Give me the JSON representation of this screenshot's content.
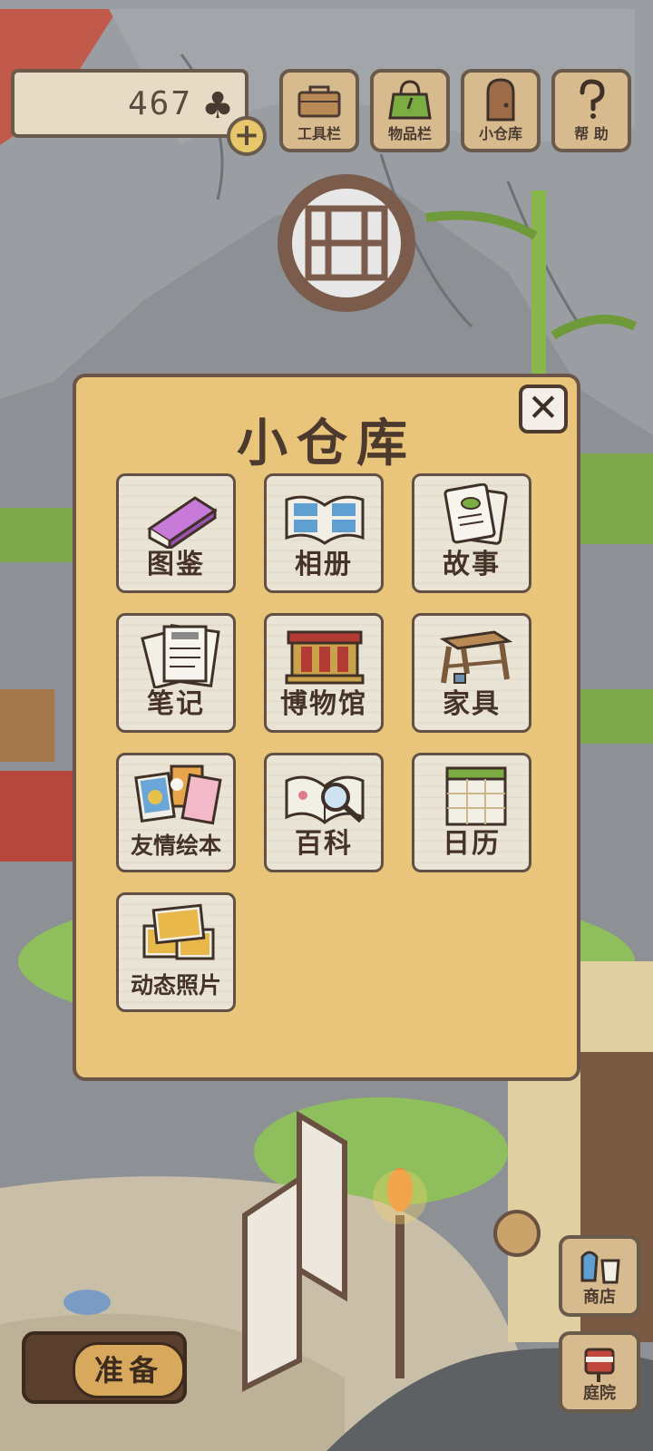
{
  "hud": {
    "clover_count": "467",
    "clover_icon": "clover-icon",
    "add_icon": "plus-icon"
  },
  "toolbar": [
    {
      "label": "工具栏",
      "icon": "toolbox-icon"
    },
    {
      "label": "物品栏",
      "icon": "bag-icon"
    },
    {
      "label": "小仓库",
      "icon": "door-icon"
    },
    {
      "label": "帮 助",
      "icon": "question-icon"
    }
  ],
  "storage_panel": {
    "title": "小仓库",
    "close_icon": "close-icon",
    "items": [
      {
        "label": "图鉴",
        "icon": "book-icon"
      },
      {
        "label": "相册",
        "icon": "album-icon"
      },
      {
        "label": "故事",
        "icon": "story-cards-icon"
      },
      {
        "label": "笔记",
        "icon": "notes-icon"
      },
      {
        "label": "博物馆",
        "icon": "museum-icon"
      },
      {
        "label": "家具",
        "icon": "furniture-icon"
      },
      {
        "label": "友情绘本",
        "icon": "friendship-book-icon"
      },
      {
        "label": "百科",
        "icon": "encyclopedia-icon"
      },
      {
        "label": "日历",
        "icon": "calendar-icon"
      },
      {
        "label": "动态照片",
        "icon": "live-photos-icon"
      }
    ]
  },
  "bottom": {
    "prepare_label": "准备",
    "shop_label": "商店",
    "yard_label": "庭院"
  },
  "colors": {
    "panel_bg": "#e9c47b",
    "tile_bg": "#eae4d6",
    "button_bg": "#d7bb8f",
    "outline": "#6a5a4c"
  }
}
